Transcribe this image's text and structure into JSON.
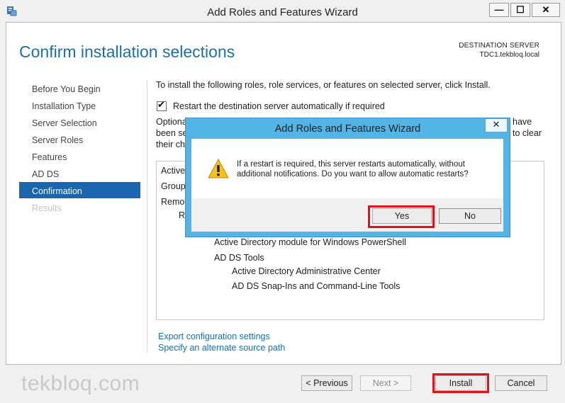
{
  "window": {
    "title": "Add Roles and Features Wizard",
    "minimize": "—",
    "maximize": "☐",
    "close": "✕"
  },
  "page": {
    "heading": "Confirm installation selections",
    "destination_label": "DESTINATION SERVER",
    "destination_value": "TDC1.tekbloq.local"
  },
  "nav": {
    "items": [
      {
        "label": "Before You Begin",
        "state": "normal"
      },
      {
        "label": "Installation Type",
        "state": "normal"
      },
      {
        "label": "Server Selection",
        "state": "normal"
      },
      {
        "label": "Server Roles",
        "state": "normal"
      },
      {
        "label": "Features",
        "state": "normal"
      },
      {
        "label": "AD DS",
        "state": "normal"
      },
      {
        "label": "Confirmation",
        "state": "active"
      },
      {
        "label": "Results",
        "state": "disabled"
      }
    ]
  },
  "main": {
    "instruction": "To install the following roles, role services, or features on selected server, click Install.",
    "restart_checkbox": {
      "label": "Restart the destination server automatically if required",
      "checked": true
    },
    "optional_left": [
      "Optiona",
      "been se",
      "their ch"
    ],
    "optional_right": [
      "have",
      "to clear"
    ],
    "list_items_partial": [
      "Active",
      "Group",
      "Remot",
      "Re"
    ],
    "list_items": [
      "Active Directory module for Windows PowerShell",
      "AD DS Tools",
      "Active Directory Administrative Center",
      "AD DS Snap-Ins and Command-Line Tools"
    ],
    "links": {
      "export": "Export configuration settings",
      "alternate": "Specify an alternate source path"
    }
  },
  "footer": {
    "watermark": "tekbloq.com",
    "previous": "< Previous",
    "next": "Next >",
    "install": "Install",
    "cancel": "Cancel"
  },
  "dialog": {
    "title": "Add Roles and Features Wizard",
    "close": "✕",
    "message": "If a restart is required, this server restarts automatically, without additional notifications. Do you want to allow automatic restarts?",
    "yes": "Yes",
    "no": "No"
  },
  "colors": {
    "accent": "#1b6fa8",
    "nav_active": "#1a67b0",
    "dialog_frame": "#52b5e6",
    "highlight": "#e0131a"
  }
}
